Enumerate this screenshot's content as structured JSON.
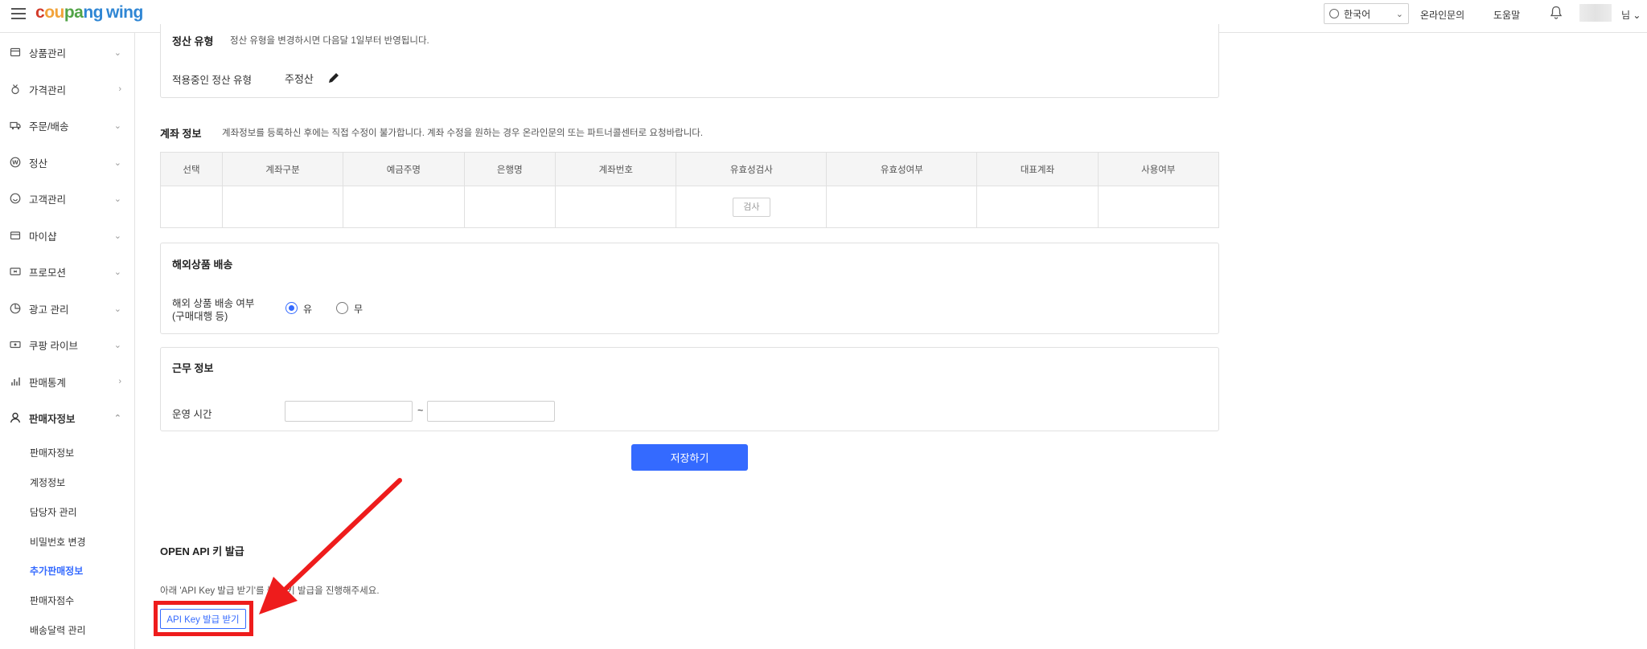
{
  "header": {
    "logo": {
      "c": "c",
      "ou": "ou",
      "pa": "pa",
      "ng": "ng",
      "wing": "wing"
    },
    "language": "한국어",
    "links": [
      "온라인문의",
      "도움말"
    ],
    "user_suffix": "님"
  },
  "sidebar": {
    "items": [
      {
        "label": "상품관리",
        "icon": "box-icon",
        "chevron": "down"
      },
      {
        "label": "가격관리",
        "icon": "medal-icon",
        "chevron": "right"
      },
      {
        "label": "주문/배송",
        "icon": "truck-icon",
        "chevron": "down"
      },
      {
        "label": "정산",
        "icon": "won-coin-icon",
        "chevron": "down"
      },
      {
        "label": "고객관리",
        "icon": "smile-icon",
        "chevron": "down"
      },
      {
        "label": "마이샵",
        "icon": "shop-icon",
        "chevron": "down"
      },
      {
        "label": "프로모션",
        "icon": "ticket-icon",
        "chevron": "down"
      },
      {
        "label": "광고 관리",
        "icon": "pie-chart-icon",
        "chevron": "down"
      },
      {
        "label": "쿠팡 라이브",
        "icon": "live-icon",
        "chevron": "down"
      },
      {
        "label": "판매통계",
        "icon": "bar-chart-icon",
        "chevron": "right"
      },
      {
        "label": "판매자정보",
        "icon": "person-icon",
        "chevron": "up"
      }
    ],
    "sub_items": [
      "판매자정보",
      "계정정보",
      "담당자 관리",
      "비밀번호 변경",
      "추가판매정보",
      "판매자점수",
      "배송달력 관리"
    ]
  },
  "settlement": {
    "title": "정산 유형",
    "desc": "정산 유형을 변경하시면 다음달 1일부터 반영됩니다.",
    "current_label": "적용중인 정산 유형",
    "current_value": "주정산"
  },
  "account": {
    "title": "계좌 정보",
    "desc": "계좌정보를 등록하신 후에는 직접 수정이 불가합니다. 계좌 수정을 원하는 경우 온라인문의 또는 파트너콜센터로 요청바랍니다.",
    "columns": [
      "선택",
      "계좌구분",
      "예금주명",
      "은행명",
      "계좌번호",
      "유효성검사",
      "유효성여부",
      "대표계좌",
      "사용여부"
    ],
    "check_button": "검사"
  },
  "overseas": {
    "title": "해외상품 배송",
    "label_line1": "해외 상품 배송 여부",
    "label_line2": "(구매대행 등)",
    "options": [
      "유",
      "무"
    ],
    "selected": "유"
  },
  "work": {
    "title": "근무 정보",
    "hours_label": "운영 시간",
    "separator": "~",
    "start_value": "",
    "end_value": ""
  },
  "save_button": "저장하기",
  "open_api": {
    "title": "OPEN API 키 발급",
    "desc": "아래 'API Key 발급 받기'를 눌러 키 발급을 진행해주세요.",
    "button": "API Key 발급 받기"
  },
  "colors": {
    "accent": "#346aff",
    "annotation": "#ee1c1c"
  }
}
